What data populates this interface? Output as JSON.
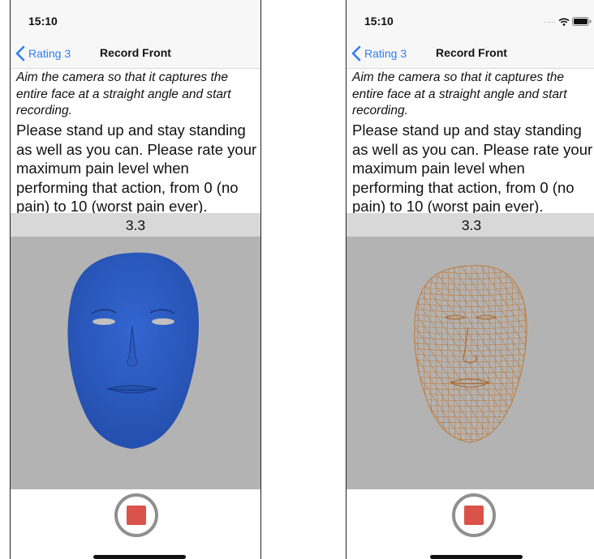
{
  "screens": [
    {
      "status_bar": {
        "time": "15:10"
      },
      "nav": {
        "back_label": "Rating 3",
        "title": "Record Front"
      },
      "instruction": "Aim the camera so that it captures the entire face at a straight angle and start recording.",
      "question": "Please stand up and stay standing as well as you can.  Please rate your maximum pain level when performing that action, from 0 (no pain) to 10 (worst pain ever).",
      "rating_value": "3.3",
      "face_render": {
        "style": "solid",
        "color": "#2a5dc6"
      }
    },
    {
      "status_bar": {
        "time": "15:10"
      },
      "nav": {
        "back_label": "Rating 3",
        "title": "Record Front"
      },
      "instruction": "Aim the camera so that it captures the entire face at a straight angle and start recording.",
      "question": "Please stand up and stay standing as well as you can.  Please rate your maximum pain level when performing that action, from 0 (no pain) to 10 (worst pain ever).",
      "rating_value": "3.3",
      "face_render": {
        "style": "wireframe",
        "color": "#c07a3a"
      }
    }
  ],
  "colors": {
    "accent": "#2f7ef5",
    "record": "#d9534a",
    "camera_bg": "#b3b3b3",
    "rating_bg": "#d8d8d8"
  }
}
